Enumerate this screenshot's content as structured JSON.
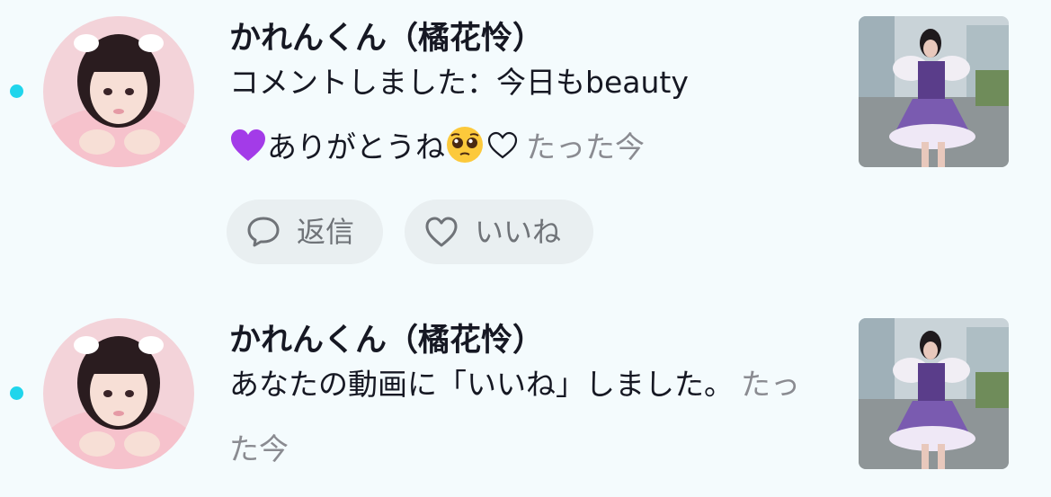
{
  "notifications": [
    {
      "username": "かれんくん（橘花怜）",
      "message_text": "コメントしました：今日もbeauty",
      "message_tail": "ありがとうね",
      "time": "たった今",
      "actions": {
        "reply_label": "返信",
        "like_label": "いいね"
      },
      "emoji": [
        "purple-heart",
        "pleading-face",
        "white-heart"
      ],
      "unread": true
    },
    {
      "username": "かれんくん（橘花怜）",
      "message_text": "あなたの動画に「いいね」しました。",
      "time": "たった今",
      "unread": true
    }
  ],
  "colors": {
    "background": "#f4fbfd",
    "unread_dot": "#20d5ec",
    "time_text": "#8a8b91",
    "pill_background": "#e9eff1",
    "pill_text": "#6f7378",
    "purple_heart": "#a33be8"
  }
}
